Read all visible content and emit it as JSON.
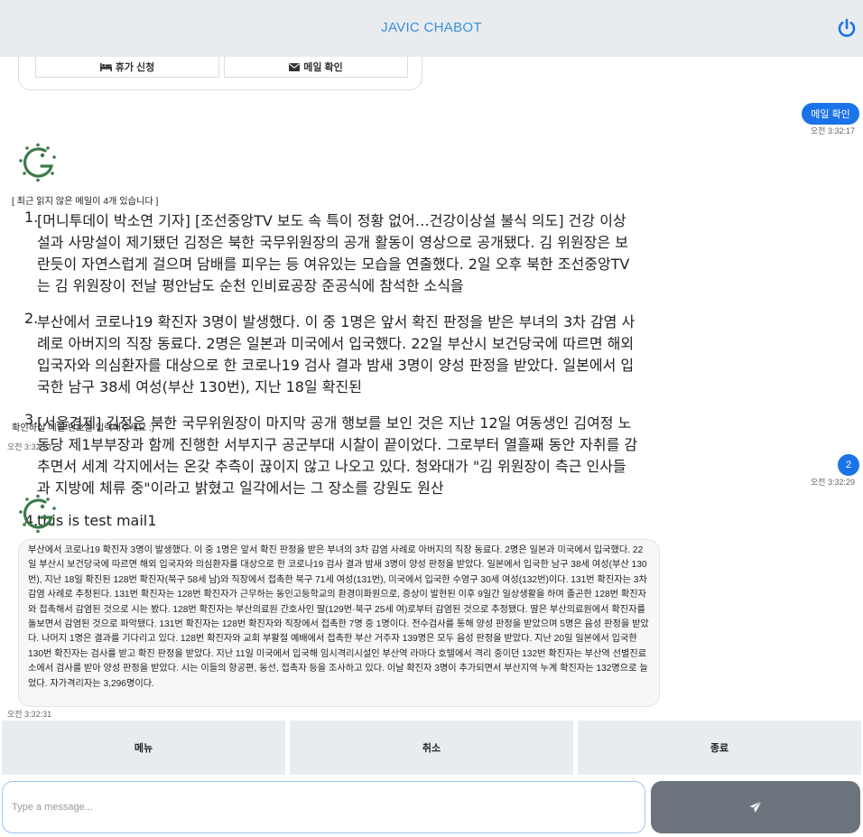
{
  "header": {
    "title": "JAVIC CHABOT",
    "power_icon": "power-icon"
  },
  "menu_card": {
    "vacation_label": "휴가 신청",
    "vacation_icon": "bed-icon",
    "mail_label": "메일 확인",
    "mail_icon": "envelope-icon"
  },
  "messages": {
    "user1": {
      "text": "메일 확인",
      "time": "오전 3:32:17"
    },
    "bot1": {
      "intro": "[ 최근 읽지 않은 메일이 4개 있습니다 ]",
      "items": [
        {
          "num": "1.",
          "text": "[머니투데이 박소연 기자] [조선중앙TV 보도 속 특이 정황 없어…건강이상설 불식 의도] 건강 이상설과 사망설이 제기됐던 김정은 북한 국무위원장의 공개 활동이 영상으로 공개됐다. 김 위원장은 보란듯이 자연스럽게 걸으며 담배를 피우는 등 여유있는 모습을 연출했다. 2일 오후 북한 조선중앙TV는 김 위원장이 전날 평안남도 순천 인비료공장 준공식에 참석한 소식을"
        },
        {
          "num": "2.",
          "text": "부산에서 코로나19 확진자 3명이 발생했다. 이 중 1명은 앞서 확진 판정을 받은 부녀의 3차 감염 사례로 아버지의 직장 동료다. 2명은 일본과 미국에서 입국했다. 22일 부산시 보건당국에 따르면 해외 입국자와 의심환자를 대상으로 한 코로나19 검사 결과 밤새 3명이 양성 판정을 받았다. 일본에서 입국한 남구 38세 여성(부산 130번), 지난 18일 확진된"
        },
        {
          "num": "3.",
          "text": "[서울경제] 김정은 북한 국무위원장이 마지막 공개 행보를 보인 것은 지난 12일 여동생인 김여정 노동당 제1부부장과 함께 진행한 서부지구 공군부대 시찰이 끝이었다. 그로부터 열흘째 동안 자취를 감추면서 세계 각지에서는 온갖 추측이 끊이지 않고 나오고 있다. 청와대가 \"김 위원장이 측근 인사들과 지방에 체류 중\"이라고 밝혔고 일각에서는 그 장소를 강원도 원산"
        },
        {
          "num": "4.",
          "text": "this is test mail1"
        }
      ],
      "prompt": "확인하실 메일 번호를 입력해주세요 :)",
      "time": "오전 3:32:22"
    },
    "user2": {
      "text": "2",
      "time": "오전 3:32:29"
    },
    "bot2": {
      "text": "부산에서 코로나19 확진자 3명이 발생했다. 이 중 1명은 앞서 확진 판정을 받은 부녀의 3차 감염 사례로 아버지의 직장 동료다. 2명은 일본과 미국에서 입국했다. 22일 부산시 보건당국에 따르면 해외 입국자와 의심환자를 대상으로 한 코로나19 검사 결과 밤새 3명이 양성 판정을 받았다. 일본에서 입국한 남구 38세 여성(부산 130번), 지난 18일 확진된 128번 확진자(북구 58세 남)와 직장에서 접촉한 북구 71세 여성(131번), 미국에서 입국한 수영구 30세 여성(132번)이다. 131번 확진자는 3차 감염 사례로 추정된다. 131번 확진자는 128번 확진자가 근무하는 동인고등학교의 환경미화원으로, 증상이 발현된 이후 9일간 일상생활을 하며 졸곤한 128번 확진자와 접촉해서 감염된 것으로 시는 봤다. 128번 확진자는 부산의료원 간호사인 딸(129번·북구 25세 여)로부터 감염된 것으로 추정됐다. 딸은 부산의료원에서 확진자를 돌보면서 감염된 것으로 파악됐다. 131번 확진자는 128번 확진자와 직장에서 접촉한 7명 중 1명이다. 전수검사를 통해 양성 판정을 받았으며 5명은 음성 판정을 받았다. 나머지 1명은 결과를 기다리고 있다. 128번 확진자와 교회 부활절 예배에서 접촉한 부산 거주자 139명은 모두 음성 판정을 받았다. 지난 20일 일본에서 입국한 130번 확진자는 검사를 받고 확진 판정을 받았다. 지난 11일 미국에서 입국해 임시격리시설인 부산역 라마다 호텔에서 격리 중이던 132번 확진자는 부산역 선별진료소에서 검사를 받아 양성 판정을 받았다. 시는 이들의 항공편, 동선, 접촉자 등을 조사하고 있다. 이날 확진자 3명이 추가되면서 부산지역 누계 확진자는 132명으로 늘었다. 자가격리자는 3,296명이다.",
      "time": "오전 3:32:31"
    }
  },
  "actions": {
    "menu": "메뉴",
    "cancel": "취소",
    "exit": "종료"
  },
  "composer": {
    "placeholder": "Type a message...",
    "send_icon": "paper-plane-icon"
  },
  "colors": {
    "header_bg": "#e9ecef",
    "accent": "#1a73e8",
    "title": "#3a8fd8",
    "send_bg": "#6c757d"
  }
}
